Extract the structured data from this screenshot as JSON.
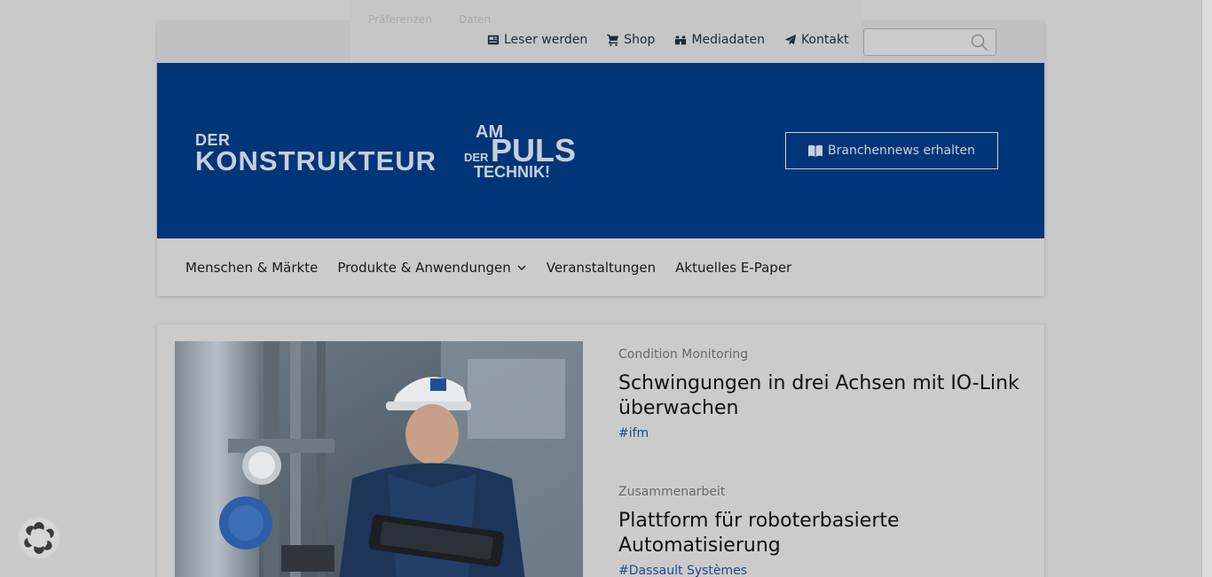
{
  "consent_overlay": {
    "tab_preferences": "Präferenzen",
    "tab_data": "Daten"
  },
  "topbar": {
    "links": [
      {
        "label": "Leser werden",
        "icon": "newspaper-icon"
      },
      {
        "label": "Shop",
        "icon": "cart-icon"
      },
      {
        "label": "Mediadaten",
        "icon": "binoculars-icon"
      },
      {
        "label": "Kontakt",
        "icon": "paper-plane-icon"
      }
    ],
    "search_placeholder": ""
  },
  "hero": {
    "logo_der": "DER",
    "logo_konstrukteur": "KONSTRUKTEUR",
    "puls_am": "AM",
    "puls_puls": "PULS",
    "puls_der": "DER",
    "puls_technik": "TECHNIK!",
    "cta_label": "Branchennews erhalten"
  },
  "nav": {
    "items": [
      {
        "label": "Menschen & Märkte"
      },
      {
        "label": "Produkte & Anwendungen",
        "has_dropdown": true
      },
      {
        "label": "Veranstaltungen"
      },
      {
        "label": "Aktuelles E-Paper"
      }
    ]
  },
  "articles": [
    {
      "category": "Condition Monitoring",
      "title": "Schwingungen in drei Achsen mit IO-Link überwachen",
      "tag": "#ifm"
    },
    {
      "category": "Zusammenarbeit",
      "title": "Plattform für roboterbasierte Automatisierung",
      "tag": "#Dassault Systèmes"
    }
  ],
  "colors": {
    "brand_blue": "#003677",
    "tag_blue": "#1f4b86",
    "logo_text": "#c7cfdc"
  }
}
